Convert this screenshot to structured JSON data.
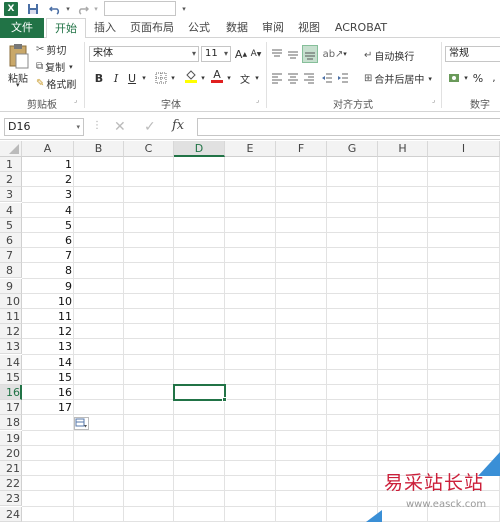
{
  "app": {
    "accent_color": "#217346",
    "icon": "excel-icon",
    "quick_access": [
      "save-icon",
      "undo-icon",
      "redo-icon"
    ]
  },
  "tabs": [
    {
      "label": "文件"
    },
    {
      "label": "开始"
    },
    {
      "label": "插入"
    },
    {
      "label": "页面布局"
    },
    {
      "label": "公式"
    },
    {
      "label": "数据"
    },
    {
      "label": "审阅"
    },
    {
      "label": "视图"
    },
    {
      "label": "ACROBAT"
    }
  ],
  "ribbon": {
    "clipboard": {
      "paste": "粘贴",
      "cut": "剪切",
      "copy": "复制",
      "format_painter": "格式刷",
      "group_label": "剪贴板"
    },
    "font": {
      "font_name": "宋体",
      "font_size": "11",
      "grow": "A",
      "shrink": "A",
      "bold": "B",
      "italic": "I",
      "underline": "U",
      "font_color_glyph": "A",
      "phonetic": "文",
      "group_label": "字体"
    },
    "alignment": {
      "wrap_text": "自动换行",
      "merge_center": "合并后居中",
      "group_label": "对齐方式"
    },
    "number": {
      "format": "常规",
      "percent": "%",
      "group_label": "数字"
    }
  },
  "formula_bar": {
    "name_box": "D16",
    "fx": "fx",
    "formula": ""
  },
  "sheet": {
    "columns": [
      "A",
      "B",
      "C",
      "D",
      "E",
      "F",
      "G",
      "H",
      "I"
    ],
    "rows": [
      "1",
      "2",
      "3",
      "4",
      "5",
      "6",
      "7",
      "8",
      "9",
      "10",
      "11",
      "12",
      "13",
      "14",
      "15",
      "16",
      "17",
      "18",
      "19",
      "20",
      "21",
      "22",
      "23",
      "24"
    ],
    "column_a_values": [
      "1",
      "2",
      "3",
      "4",
      "5",
      "6",
      "7",
      "8",
      "9",
      "10",
      "11",
      "12",
      "13",
      "14",
      "15",
      "16",
      "17"
    ],
    "active_cell": "D16"
  },
  "watermark": {
    "title": "易采站长站",
    "url": "www.easck.com"
  }
}
